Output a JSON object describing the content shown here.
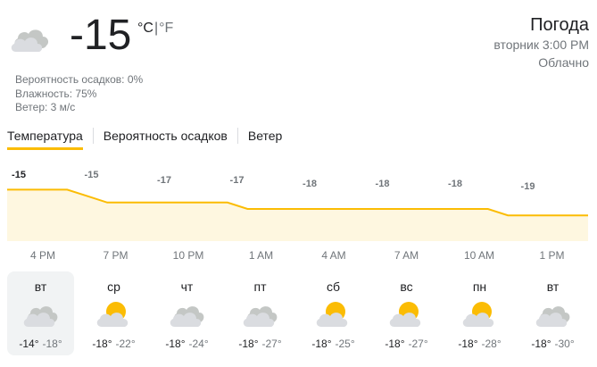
{
  "current": {
    "temperature": "-15",
    "unit_c": "°C",
    "unit_sep": "|",
    "unit_f": "°F",
    "icon": "cloudy-icon",
    "precipitation": "Вероятность осадков: 0%",
    "humidity": "Влажность: 75%",
    "wind": "Ветер: 3 м/с"
  },
  "header": {
    "title": "Погода",
    "time": "вторник 3:00 PM",
    "condition": "Облачно"
  },
  "tabs": [
    {
      "label": "Температура",
      "active": true
    },
    {
      "label": "Вероятность осадков",
      "active": false
    },
    {
      "label": "Ветер",
      "active": false
    }
  ],
  "chart_data": {
    "type": "area",
    "series": [
      {
        "values": [
          -15,
          -15,
          -15,
          -15,
          -16,
          -17,
          -17,
          -17,
          -17,
          -17,
          -17,
          -17,
          -18,
          -18,
          -18,
          -18,
          -18,
          -18,
          -18,
          -18,
          -18,
          -18,
          -18,
          -18,
          -18,
          -19,
          -19,
          -19,
          -19,
          -19
        ]
      }
    ],
    "value_labels": [
      "-15",
      "-15",
      "-17",
      "-17",
      "-18",
      "-18",
      "-18",
      "-19"
    ],
    "hour_labels": [
      "4 PM",
      "7 PM",
      "10 PM",
      "1 AM",
      "4 AM",
      "7 AM",
      "10 AM",
      "1 PM"
    ],
    "colors": {
      "line": "#fbbc04",
      "fill": "#fef7e0"
    }
  },
  "days": [
    {
      "name": "вт",
      "high": "-14°",
      "low": "-18°",
      "icon": "cloudy-icon",
      "selected": true
    },
    {
      "name": "ср",
      "high": "-18°",
      "low": "-22°",
      "icon": "partly-cloudy-icon",
      "selected": false
    },
    {
      "name": "чт",
      "high": "-18°",
      "low": "-24°",
      "icon": "cloudy-icon",
      "selected": false
    },
    {
      "name": "пт",
      "high": "-18°",
      "low": "-27°",
      "icon": "cloudy-icon",
      "selected": false
    },
    {
      "name": "сб",
      "high": "-18°",
      "low": "-25°",
      "icon": "partly-cloudy-icon",
      "selected": false
    },
    {
      "name": "вс",
      "high": "-18°",
      "low": "-27°",
      "icon": "partly-cloudy-icon",
      "selected": false
    },
    {
      "name": "пн",
      "high": "-18°",
      "low": "-28°",
      "icon": "partly-cloudy-icon",
      "selected": false
    },
    {
      "name": "вт",
      "high": "-18°",
      "low": "-30°",
      "icon": "cloudy-icon",
      "selected": false
    }
  ]
}
